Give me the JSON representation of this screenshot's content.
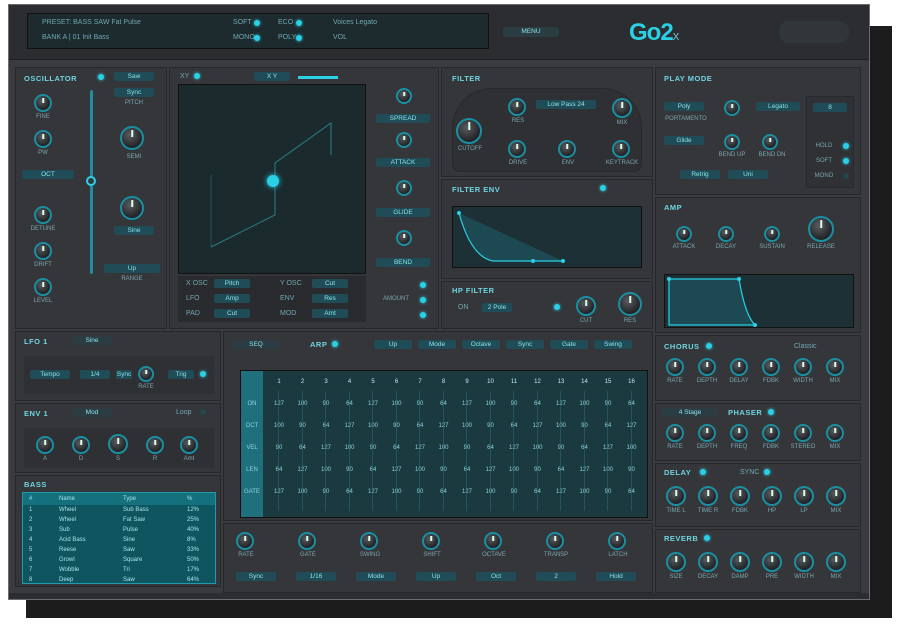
{
  "app": {
    "logo_text": "Go2",
    "logo_sub": "x"
  },
  "header": {
    "preset_lcd": {
      "line1": "PRESET: BASS SAW  Fat Pulse",
      "line2": "BANK  A  |  01  Init Bass",
      "opt1": "SOFT",
      "opt2": "ECO",
      "voices": "Voices  Legato",
      "mode": "MONO",
      "poly": "POLY",
      "vol": "VOL"
    },
    "menu_button": "MENU"
  },
  "osc": {
    "title": "OSCILLATOR",
    "wave_select": "Saw",
    "octave": "OCT",
    "pitch_label": "PITCH",
    "pitch_select": "Sync",
    "semi_label": "SEMI",
    "sub_select": "Sine",
    "knobs": [
      "FINE",
      "PW",
      "DETUNE",
      "DRIFT",
      "LEVEL"
    ],
    "range_label": "RANGE",
    "range_select": "Up"
  },
  "xy": {
    "mode": "XY",
    "assign": "X Y",
    "footer": [
      [
        "X OSC",
        "Pitch",
        "Y OSC",
        "Cut"
      ],
      [
        "LFO",
        "Amp",
        "ENV",
        "Res"
      ],
      [
        "PAD",
        "Cut",
        "MOD",
        "Amt"
      ]
    ],
    "side_labels": [
      "SPREAD",
      "ATTACK",
      "GLIDE",
      "BEND",
      "AMOUNT"
    ]
  },
  "filter": {
    "title": "FILTER",
    "type": "Low Pass 24",
    "knobs": [
      "CUTOFF",
      "RES",
      "DRIVE",
      "ENV",
      "KEYTRACK"
    ],
    "mix_label": "MIX"
  },
  "filter_env": {
    "title": "FILTER ENV"
  },
  "hp_filter": {
    "title": "HP FILTER",
    "on": "ON",
    "mode": "2 Pole",
    "knobs": [
      "CUT",
      "RES"
    ]
  },
  "play_mode": {
    "title": "PLAY MODE",
    "mode1": "Poly",
    "mode2": "Legato",
    "btn1": "Glide",
    "btn2": "Retrig",
    "btn3": "Uni",
    "voices": "8",
    "labels": [
      "PORTAMENTO",
      "BEND UP",
      "BEND DN"
    ],
    "toggles": [
      "HOLD",
      "SOFT",
      "MONO"
    ]
  },
  "amp": {
    "title": "AMP",
    "knobs": [
      "ATTACK",
      "DECAY",
      "SUSTAIN",
      "RELEASE"
    ]
  },
  "lfo": {
    "title": "LFO 1",
    "sub": "Sine",
    "labels": [
      "Tempo",
      "1/4",
      "Sync",
      "RATE",
      "Trig"
    ]
  },
  "env": {
    "title": "ENV 1",
    "sub": "Mod",
    "labels": [
      "A",
      "D",
      "S",
      "R",
      "Amt"
    ],
    "mode": "Loop"
  },
  "bass": {
    "title": "BASS",
    "headers": [
      "#",
      "Name",
      "Type",
      "%"
    ],
    "rows": [
      [
        "1",
        "Wheel",
        "Sub Bass",
        "12%"
      ],
      [
        "2",
        "Wheel",
        "Fat Saw",
        "25%"
      ],
      [
        "3",
        "Sub",
        "Pulse",
        "40%"
      ],
      [
        "4",
        "Acid Bass",
        "Sine",
        "8%"
      ],
      [
        "5",
        "Reese",
        "Saw",
        "33%"
      ],
      [
        "6",
        "Growl",
        "Square",
        "50%"
      ],
      [
        "7",
        "Wobble",
        "Tri",
        "17%"
      ],
      [
        "8",
        "Deep",
        "Saw",
        "64%"
      ]
    ]
  },
  "arp": {
    "title": "ARP",
    "mode": "SEQ",
    "options": [
      "Up",
      "Mode",
      "Octave",
      "Sync",
      "Gate",
      "Swing"
    ],
    "steps": [
      "1",
      "2",
      "3",
      "4",
      "5",
      "6",
      "7",
      "8",
      "9",
      "10",
      "11",
      "12",
      "13",
      "14",
      "15",
      "16"
    ],
    "rows": [
      "ON",
      "OCT",
      "VEL",
      "LEN",
      "GATE"
    ],
    "step_values": [
      "127",
      "100",
      "90",
      "64"
    ]
  },
  "bottom": {
    "knobs": [
      "RATE",
      "GATE",
      "SWING",
      "SHIFT",
      "OCTAVE",
      "TRANSP",
      "LATCH"
    ],
    "buttons": [
      "Sync",
      "1/16",
      "Mode",
      "Up",
      "Oct",
      "2",
      "Hold"
    ]
  },
  "chorus": {
    "title": "CHORUS",
    "mode": "Classic",
    "knobs": [
      "RATE",
      "DEPTH",
      "DELAY",
      "FDBK",
      "WIDTH",
      "MIX"
    ]
  },
  "phaser": {
    "title": "PHASER",
    "mode": "4 Stage",
    "knobs": [
      "RATE",
      "DEPTH",
      "FREQ",
      "FDBK",
      "STEREO",
      "MIX"
    ]
  },
  "delay": {
    "title": "DELAY",
    "sync": "SYNC",
    "knobs": [
      "TIME L",
      "TIME R",
      "FDBK",
      "HP",
      "LP",
      "MIX"
    ]
  },
  "reverb": {
    "title": "REVERB",
    "knobs": [
      "SIZE",
      "DECAY",
      "DAMP",
      "PRE",
      "WIDTH",
      "MIX"
    ]
  },
  "colors": {
    "accent": "#2ad0e6",
    "panel": "#35363a",
    "lcd": "#1d2a2e"
  }
}
